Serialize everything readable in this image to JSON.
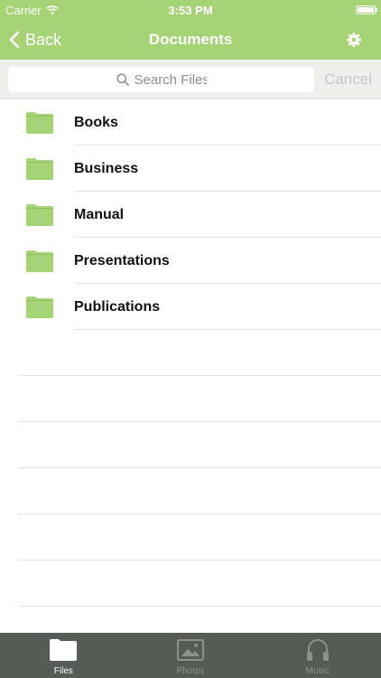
{
  "status_bar": {
    "carrier": "Carrier",
    "time": "3:53 PM"
  },
  "nav": {
    "back_label": "Back",
    "title": "Documents",
    "settings_icon": "gear-icon"
  },
  "search": {
    "placeholder": "Search Files",
    "cancel_label": "Cancel"
  },
  "files": [
    {
      "name": "Books",
      "icon": "folder-icon"
    },
    {
      "name": "Business",
      "icon": "folder-icon"
    },
    {
      "name": "Manual",
      "icon": "folder-icon"
    },
    {
      "name": "Presentations",
      "icon": "folder-icon"
    },
    {
      "name": "Publications",
      "icon": "folder-icon"
    }
  ],
  "tabs": [
    {
      "label": "Files",
      "icon": "folder-icon",
      "active": true
    },
    {
      "label": "Photos",
      "icon": "photo-icon",
      "active": false
    },
    {
      "label": "Music",
      "icon": "headphones-icon",
      "active": false
    }
  ],
  "colors": {
    "accent": "#a6d375",
    "folder": "#a6d375",
    "tab_bar": "#555b55"
  }
}
